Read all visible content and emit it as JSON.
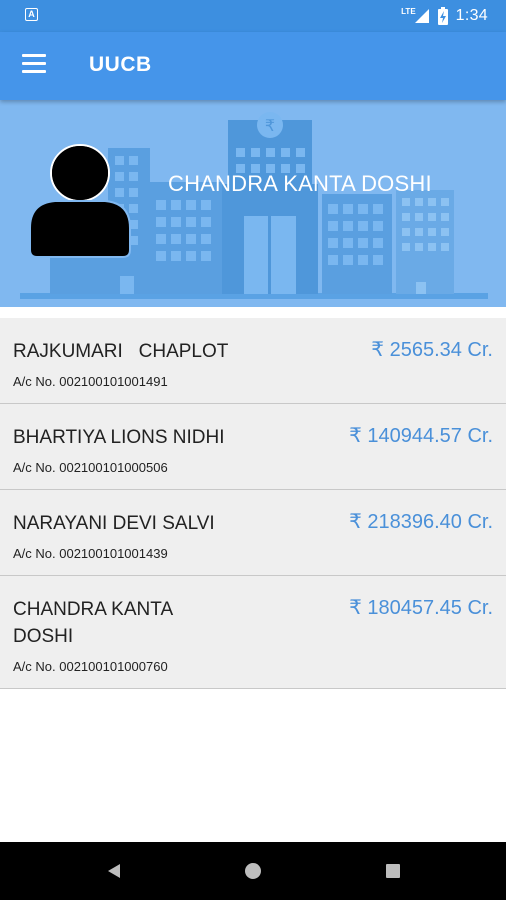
{
  "status_bar": {
    "app_icon_letter": "A",
    "network_label": "LTE",
    "time": "1:34"
  },
  "app_bar": {
    "title": "UUCB"
  },
  "header": {
    "customer_name": "CHANDRA KANTA DOSHI",
    "bank_symbol": "₹"
  },
  "accounts": [
    {
      "name": "RAJKUMARI   CHAPLOT",
      "amount": "₹ 2565.34 Cr.",
      "account_no": "A/c No. 002100101001491"
    },
    {
      "name": "BHARTIYA LIONS NIDHI",
      "amount": "₹ 140944.57 Cr.",
      "account_no": "A/c No. 002100101000506"
    },
    {
      "name": "NARAYANI DEVI SALVI",
      "amount": "₹ 218396.40 Cr.",
      "account_no": "A/c No. 002100101001439"
    },
    {
      "name": "CHANDRA KANTA\nDOSHI",
      "amount": "₹ 180457.45 Cr.",
      "account_no": "A/c No. 002100101000760"
    }
  ],
  "colors": {
    "status_bar": "#3d8fe0",
    "app_bar": "#4595ea",
    "banner": "#80b8f0",
    "amount": "#4a90d9",
    "list_bg": "#efefef"
  }
}
